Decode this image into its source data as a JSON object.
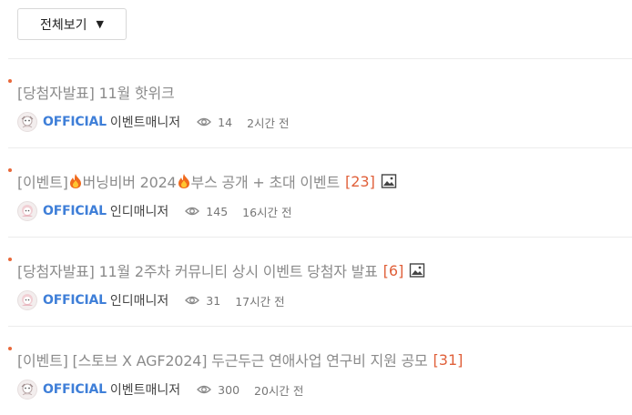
{
  "filter": {
    "label": "전체보기",
    "caret": "▼"
  },
  "posts": [
    {
      "title_prefix": "[당첨자발표] 11월 핫위크",
      "title_main": "",
      "title_suffix": "",
      "comment_count": "",
      "badge": "OFFICIAL",
      "author": "이벤트매니저",
      "views": "14",
      "time": "2시간 전"
    },
    {
      "title_prefix": "[이벤트] ",
      "title_main": "버닝비버 2024",
      "title_suffix": " 부스 공개 + 초대 이벤트",
      "comment_count": "[23]",
      "badge": "OFFICIAL",
      "author": "인디매니저",
      "views": "145",
      "time": "16시간 전"
    },
    {
      "title_prefix": "[당첨자발표] 11월 2주차 커뮤니티 상시 이벤트 당첨자 발표",
      "title_main": "",
      "title_suffix": "",
      "comment_count": "[6]",
      "badge": "OFFICIAL",
      "author": "인디매니저",
      "views": "31",
      "time": "17시간 전"
    },
    {
      "title_prefix": "[이벤트] [스토브 X AGF2024] 두근두근 연애사업 연구비 지원 공모",
      "title_main": "",
      "title_suffix": "",
      "comment_count": "[31]",
      "badge": "OFFICIAL",
      "author": "이벤트매니저",
      "views": "300",
      "time": "20시간 전"
    }
  ],
  "colors": {
    "accent": "#e0603a",
    "official": "#3f7fd8",
    "title": "#8b8b8b"
  },
  "icons": {
    "views": "eye-icon",
    "attachment": "image-icon",
    "emoji": "fire-icon"
  }
}
